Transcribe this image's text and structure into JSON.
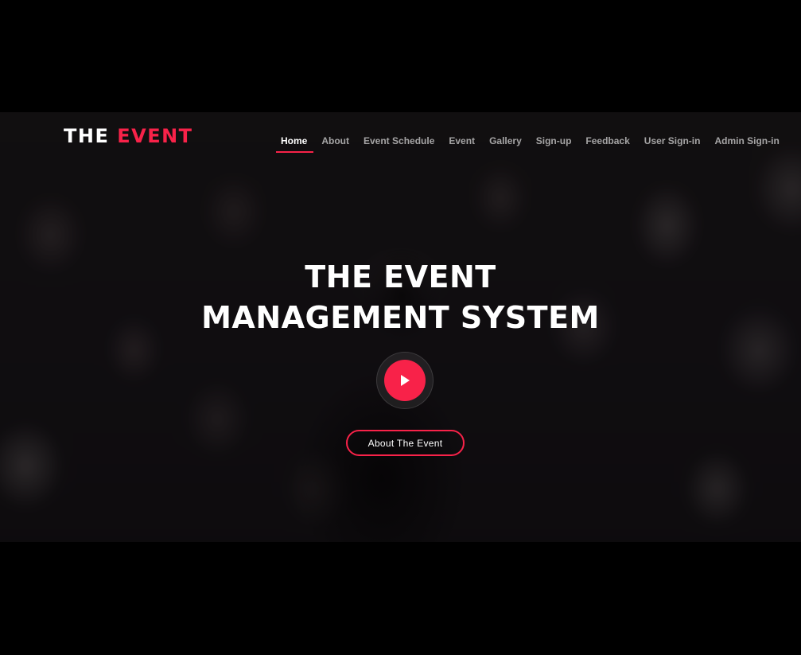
{
  "header": {
    "logo_part1": "THE ",
    "logo_part2": "EVENT"
  },
  "nav": {
    "items": [
      {
        "label": "Home",
        "active": true
      },
      {
        "label": "About"
      },
      {
        "label": "Event Schedule"
      },
      {
        "label": "Event"
      },
      {
        "label": "Gallery"
      },
      {
        "label": "Sign-up"
      },
      {
        "label": "Feedback"
      },
      {
        "label": "User Sign-in"
      },
      {
        "label": "Admin Sign-in"
      }
    ]
  },
  "hero": {
    "title_line1": "THE EVENT",
    "title_line2": "MANAGEMENT SYSTEM",
    "play_icon": "play-icon",
    "cta_label": "About The Event"
  },
  "colors": {
    "accent": "#f82249",
    "background": "#000000"
  }
}
